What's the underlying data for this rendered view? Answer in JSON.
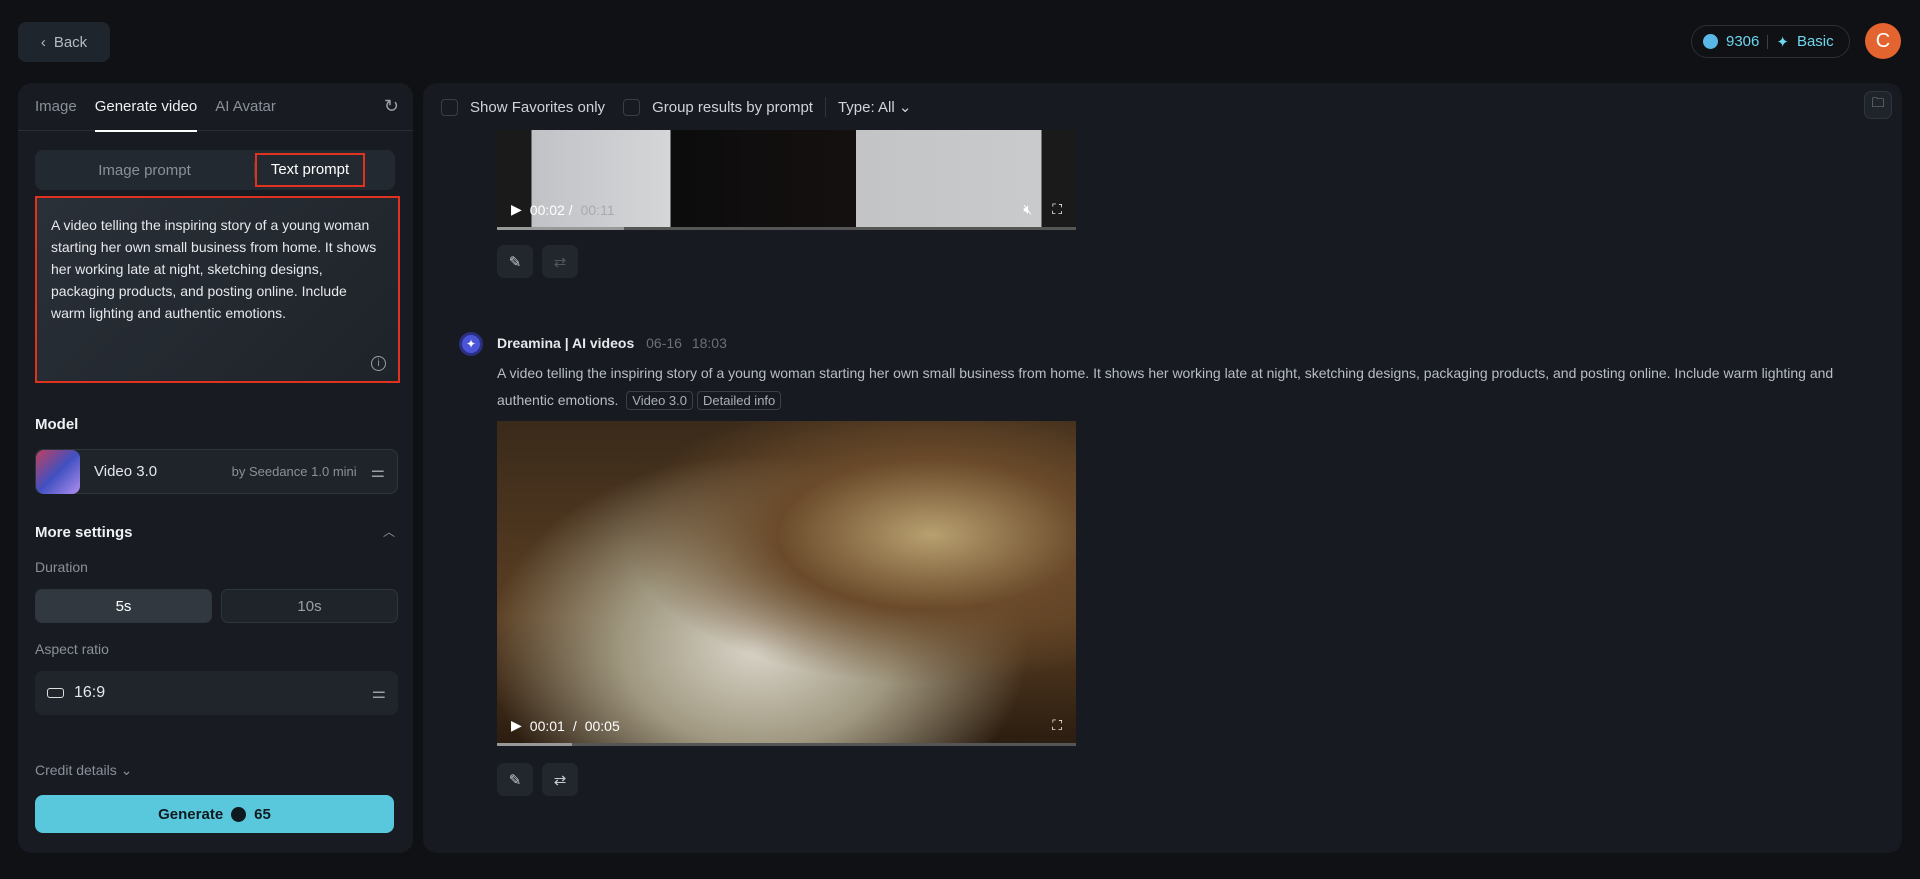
{
  "header": {
    "back_label": "Back",
    "credits": "9306",
    "plan": "Basic",
    "avatar_letter": "C"
  },
  "sidebar": {
    "tabs": [
      {
        "label": "Image"
      },
      {
        "label": "Generate video"
      },
      {
        "label": "AI Avatar"
      }
    ],
    "prompt_modes": [
      {
        "label": "Image prompt"
      },
      {
        "label": "Text prompt"
      }
    ],
    "prompt_text": "A video telling the inspiring story of a young woman starting her own small business from home. It shows her working late at night, sketching designs, packaging products, and posting online. Include warm lighting and authentic emotions.",
    "model_label": "Model",
    "model_name": "Video 3.0",
    "model_by": "by Seedance 1.0 mini",
    "more_settings": "More settings",
    "duration_label": "Duration",
    "durations": [
      "5s",
      "10s"
    ],
    "aspect_label": "Aspect ratio",
    "aspect_value": "16:9",
    "credit_details": "Credit details",
    "generate_label": "Generate",
    "generate_cost": "65"
  },
  "main": {
    "filters": {
      "favorites": "Show Favorites only",
      "group": "Group results by prompt",
      "type": "Type: All"
    },
    "video1": {
      "current": "00:02 /",
      "total": "00:11",
      "progress": 0.22
    },
    "message": {
      "author": "Dreamina | AI videos",
      "date": "06-16",
      "time": "18:03",
      "prompt": "A video telling the inspiring story of a young woman starting her own small business from home. It shows her working late at night, sketching designs, packaging products, and posting online. Include warm lighting and authentic emotions.",
      "tags": [
        "Video 3.0",
        "Detailed info"
      ]
    },
    "video2": {
      "current": "00:01",
      "sep": "/",
      "total": "00:05",
      "progress": 0.13
    }
  }
}
